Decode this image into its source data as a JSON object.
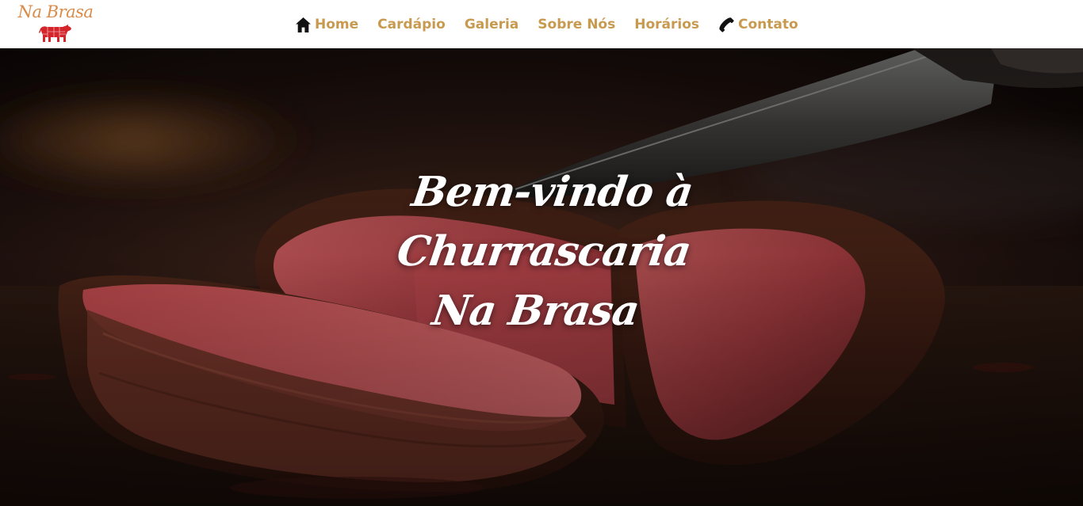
{
  "colors": {
    "nav_text": "#c79a4f",
    "logo_text": "#d98b4a",
    "logo_cow": "#d4262a",
    "icon": "#111111",
    "hero_text": "#ffffff"
  },
  "header": {
    "logo": {
      "text": "Na Brasa",
      "icon": "cow-icon"
    },
    "nav": [
      {
        "label": "Home",
        "icon": "home-icon"
      },
      {
        "label": "Cardápio"
      },
      {
        "label": "Galeria"
      },
      {
        "label": "Sobre Nós"
      },
      {
        "label": "Horários"
      },
      {
        "label": "Contato",
        "icon": "phone-icon"
      }
    ]
  },
  "hero": {
    "title_lines": [
      "Bem-vindo à",
      "Churrascaria",
      "Na Brasa"
    ]
  }
}
